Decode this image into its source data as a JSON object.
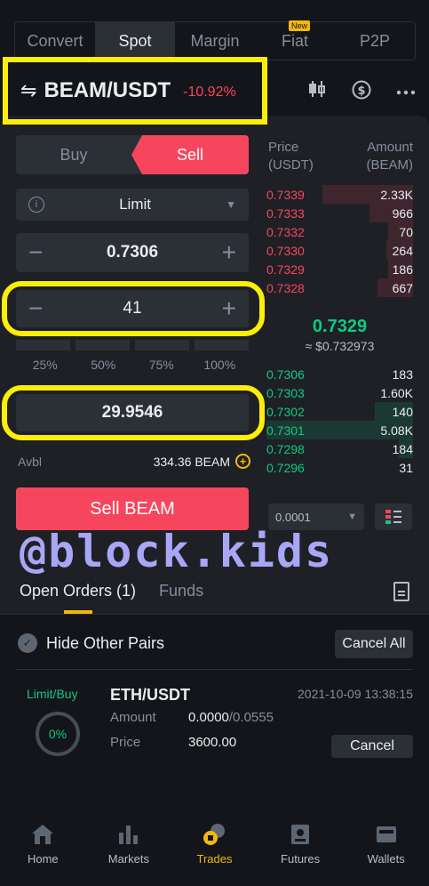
{
  "tabs": [
    {
      "label": "Convert",
      "active": false
    },
    {
      "label": "Spot",
      "active": true
    },
    {
      "label": "Margin",
      "active": false
    },
    {
      "label": "Fiat",
      "active": false,
      "badge": "New"
    },
    {
      "label": "P2P",
      "active": false
    }
  ],
  "pair": {
    "swap_icon": "⇋",
    "name": "BEAM/USDT",
    "change": "-10.92%"
  },
  "icons": {
    "chart": "candlestick-icon",
    "dollar": "dollar-circle-icon",
    "more": "more-icon"
  },
  "trade": {
    "buy_label": "Buy",
    "sell_label": "Sell",
    "order_type": "Limit",
    "price": "0.7306",
    "amount": "41",
    "total": "29.9546",
    "percents": [
      "25%",
      "50%",
      "75%",
      "100%"
    ],
    "avbl_label": "Avbl",
    "avbl_value": "334.36 BEAM",
    "submit_label": "Sell BEAM"
  },
  "orderbook": {
    "price_header": "Price",
    "price_unit": "(USDT)",
    "amount_header": "Amount",
    "amount_unit": "(BEAM)",
    "asks": [
      {
        "price": "0.7339",
        "amount": "2.33K",
        "depth": 0.62
      },
      {
        "price": "0.7333",
        "amount": "966",
        "depth": 0.3
      },
      {
        "price": "0.7332",
        "amount": "70",
        "depth": 0.17
      },
      {
        "price": "0.7330",
        "amount": "264",
        "depth": 0.18
      },
      {
        "price": "0.7329",
        "amount": "186",
        "depth": 0.17
      },
      {
        "price": "0.7328",
        "amount": "667",
        "depth": 0.24
      }
    ],
    "last_price": "0.7329",
    "last_price_usd": "≈ $0.732973",
    "bids": [
      {
        "price": "0.7306",
        "amount": "183",
        "depth": 0.0
      },
      {
        "price": "0.7303",
        "amount": "1.60K",
        "depth": 0.0
      },
      {
        "price": "0.7302",
        "amount": "140",
        "depth": 0.26
      },
      {
        "price": "0.7301",
        "amount": "5.08K",
        "depth": 1.0
      },
      {
        "price": "0.7298",
        "amount": "184",
        "depth": 0.1
      },
      {
        "price": "0.7296",
        "amount": "31",
        "depth": 0.0
      }
    ],
    "precision": "0.0001"
  },
  "watermark": "@block.kids",
  "orders": {
    "tab_open": "Open Orders (1)",
    "tab_funds": "Funds",
    "hide_pairs_label": "Hide Other Pairs",
    "cancel_all_label": "Cancel All",
    "item": {
      "type": "Limit/Buy",
      "filled": "0%",
      "pair": "ETH/USDT",
      "time": "2021-10-09 13:38:15",
      "amount_label": "Amount",
      "amount_filled": "0.0000",
      "amount_total": "/0.0555",
      "price_label": "Price",
      "price": "3600.00",
      "cancel_label": "Cancel"
    }
  },
  "nav": [
    {
      "label": "Home",
      "icon": "home-icon",
      "active": false
    },
    {
      "label": "Markets",
      "icon": "markets-icon",
      "active": false
    },
    {
      "label": "Trades",
      "icon": "trades-icon",
      "active": true
    },
    {
      "label": "Futures",
      "icon": "futures-icon",
      "active": false
    },
    {
      "label": "Wallets",
      "icon": "wallet-icon",
      "active": false
    }
  ],
  "colors": {
    "sell": "#f6465d",
    "buy": "#0ecb81",
    "accent": "#f0b90b",
    "highlight": "#fcee09"
  }
}
